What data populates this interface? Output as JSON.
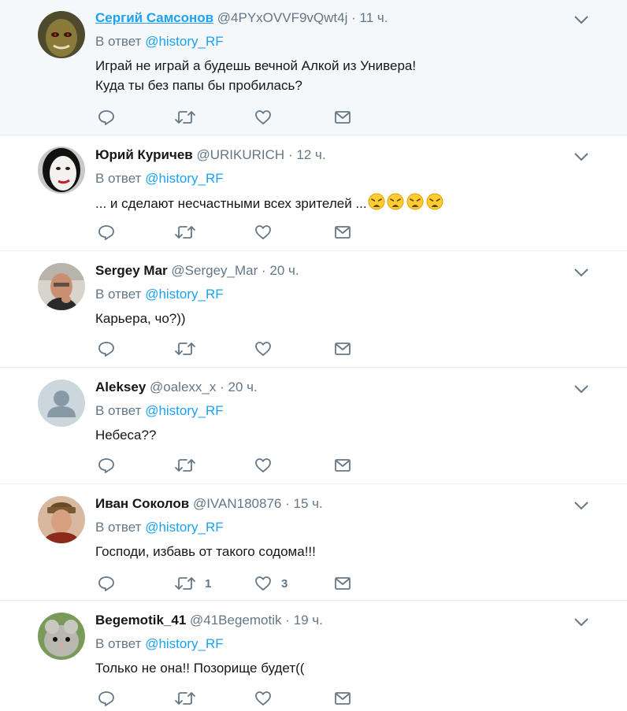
{
  "reply_prefix": "В ответ",
  "tweets": [
    {
      "name": "Сергий Самсонов",
      "handle": "@4PYxOVVF9vQwt4j",
      "sep": "·",
      "time": "11 ч.",
      "mention": "@history_RF",
      "text": "Играй не играй а будешь вечной Алкой из Универа!\nКуда ты без папы бы пробилась?",
      "retweets": "",
      "likes": ""
    },
    {
      "name": "Юрий Куричев",
      "handle": "@URIKURICH",
      "sep": "·",
      "time": "12 ч.",
      "mention": "@history_RF",
      "text": "... и сделают несчастными всех зрителей ...",
      "emoji": "weary-face-icon",
      "retweets": "",
      "likes": ""
    },
    {
      "name": "Sergey Mar",
      "handle": "@Sergey_Mar",
      "sep": "·",
      "time": "20 ч.",
      "mention": "@history_RF",
      "text": "Карьера, чо?))",
      "retweets": "",
      "likes": ""
    },
    {
      "name": "Aleksey",
      "handle": "@oalexx_x",
      "sep": "·",
      "time": "20 ч.",
      "mention": "@history_RF",
      "text": "Небеса??",
      "retweets": "",
      "likes": ""
    },
    {
      "name": "Иван Соколов",
      "handle": "@IVAN180876",
      "sep": "·",
      "time": "15 ч.",
      "mention": "@history_RF",
      "text": "Господи, избавь от такого содома!!!",
      "retweets": "1",
      "likes": "3"
    },
    {
      "name": "Begemotik_41",
      "handle": "@41Begemotik",
      "sep": "·",
      "time": "19 ч.",
      "mention": "@history_RF",
      "text": "Только не она!! Позорище будет((",
      "retweets": "",
      "likes": ""
    }
  ],
  "colors": {
    "accent": "#1da1f2",
    "muted": "#657786",
    "highlight_bg": "#f5f8fa",
    "divider": "#e6ecf0"
  }
}
